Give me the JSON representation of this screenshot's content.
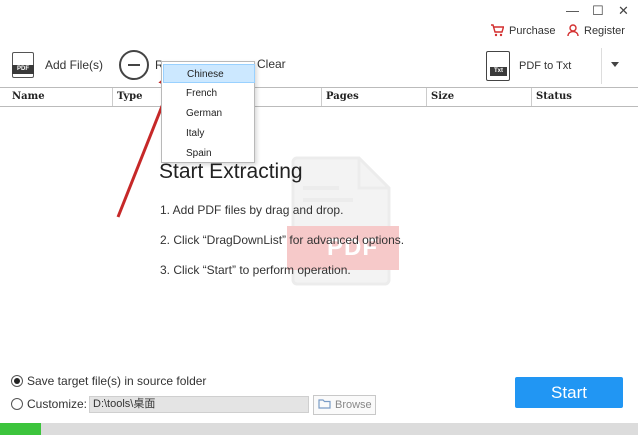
{
  "window": {
    "minimize_glyph": "—",
    "maximize_glyph": "☐",
    "close_glyph": "✕"
  },
  "topbar": {
    "purchase_label": "Purchase",
    "register_label": "Register"
  },
  "toolbar": {
    "add_files_label": "Add File(s)",
    "add_files_icon_text": "PDF",
    "remove_label_partial": "R",
    "clear_label_partial": "Clear"
  },
  "converter": {
    "icon_text": "Txt",
    "label": "PDF to Txt"
  },
  "columns": [
    "Name",
    "Type",
    "Pages",
    "Size",
    "Status"
  ],
  "language_menu": {
    "items": [
      "Chinese",
      "French",
      "German",
      "Italy",
      "Spain"
    ],
    "selected": "Chinese"
  },
  "instructions": {
    "title": "Start Extracting",
    "steps": [
      "1. Add PDF files by drag and drop.",
      "2. Click “DragDownList” for advanced options.",
      "3. Click “Start” to perform operation."
    ],
    "watermark_text": "PDF"
  },
  "output": {
    "option_source_label": "Save target file(s) in source folder",
    "option_source_selected": true,
    "option_custom_label": "Customize:",
    "option_custom_selected": false,
    "path_value": "D:\\tools\\桌面",
    "browse_label": "Browse"
  },
  "start_label": "Start",
  "progress": {
    "fraction": 0.065
  },
  "colors": {
    "accent": "#2196f3",
    "progress": "#3cc43c",
    "menu_highlight": "#cce8ff",
    "annotation_arrow": "#c62828"
  }
}
